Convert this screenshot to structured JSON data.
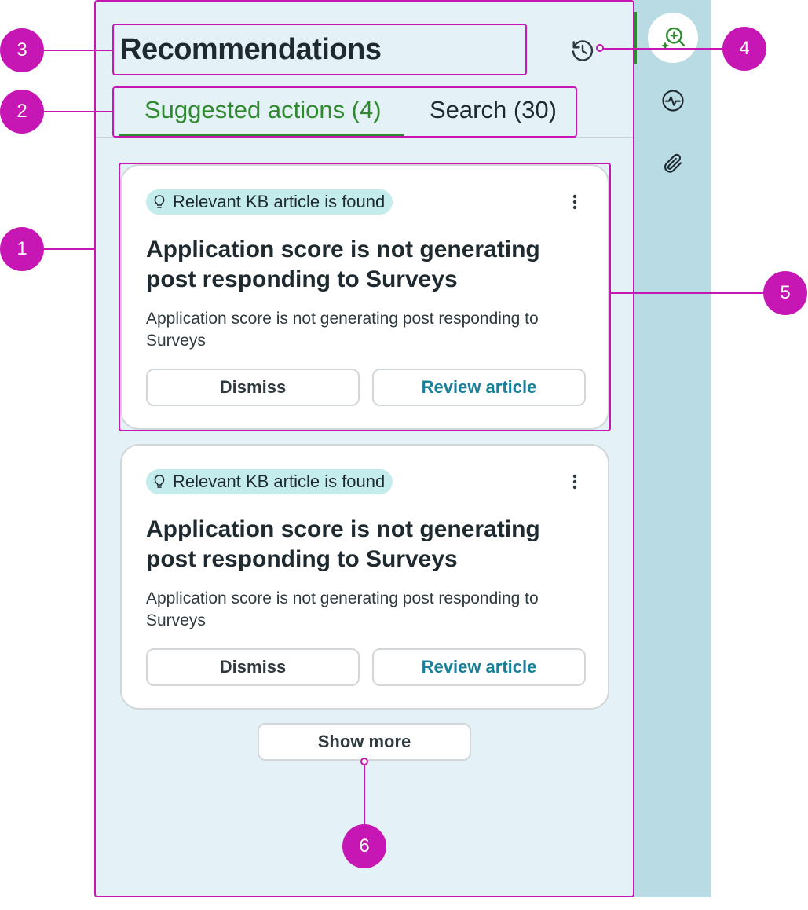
{
  "header": {
    "title": "Recommendations",
    "history_icon": "history-clock-icon"
  },
  "tabs": [
    {
      "label": "Suggested actions (4)",
      "active": true
    },
    {
      "label": "Search (30)",
      "active": false
    }
  ],
  "cards": [
    {
      "badge": "Relevant KB article is found",
      "badge_icon": "lightbulb-icon",
      "title": "Application score is not generating post responding to Surveys",
      "description": "Application score is not generating post responding to Surveys",
      "dismiss_label": "Dismiss",
      "review_label": "Review article"
    },
    {
      "badge": "Relevant KB article is found",
      "badge_icon": "lightbulb-icon",
      "title": "Application score is not generating post responding to Surveys",
      "description": "Application score is not generating post responding to Surveys",
      "dismiss_label": "Dismiss",
      "review_label": "Review article"
    }
  ],
  "show_more_label": "Show more",
  "rail": {
    "items": [
      {
        "icon": "recommendations-search-icon",
        "active": true
      },
      {
        "icon": "activity-pulse-icon",
        "active": false
      },
      {
        "icon": "paperclip-icon",
        "active": false
      }
    ]
  },
  "callouts": [
    "1",
    "2",
    "3",
    "4",
    "5",
    "6"
  ],
  "colors": {
    "accent_green": "#2f8a2f",
    "link_teal": "#1b7f9a",
    "annotation_magenta": "#c616b3",
    "panel_bg": "#e4f1f7",
    "rail_bg": "#b9dbe4",
    "badge_bg": "#c4ecec"
  }
}
